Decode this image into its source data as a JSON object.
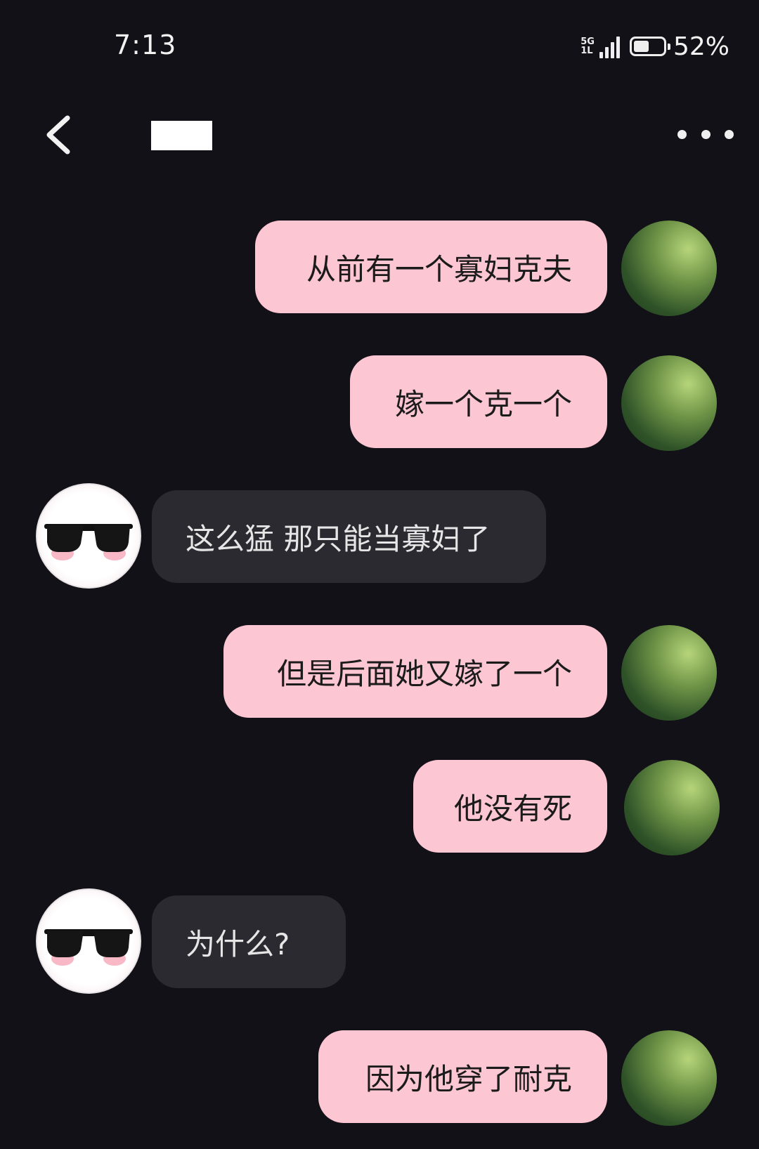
{
  "status_bar": {
    "time": "7:13",
    "network_top": "5G",
    "network_bottom": "1L",
    "battery_percent": "52%",
    "battery_level": 0.52
  },
  "header": {
    "back_icon": "chevron-left-icon",
    "more_icon": "more-horizontal-icon"
  },
  "colors": {
    "background": "#121117",
    "outgoing_bubble": "#fcc6d3",
    "incoming_bubble": "#2a2a30"
  },
  "messages": [
    {
      "sender": "me",
      "text": "从前有一个寡妇克夫"
    },
    {
      "sender": "me",
      "text": "嫁一个克一个"
    },
    {
      "sender": "them",
      "text": "这么猛 那只能当寡妇了"
    },
    {
      "sender": "me",
      "text": "但是后面她又嫁了一个"
    },
    {
      "sender": "me",
      "text": "他没有死"
    },
    {
      "sender": "them",
      "text": "为什么?"
    },
    {
      "sender": "me",
      "text": "因为他穿了耐克"
    }
  ]
}
